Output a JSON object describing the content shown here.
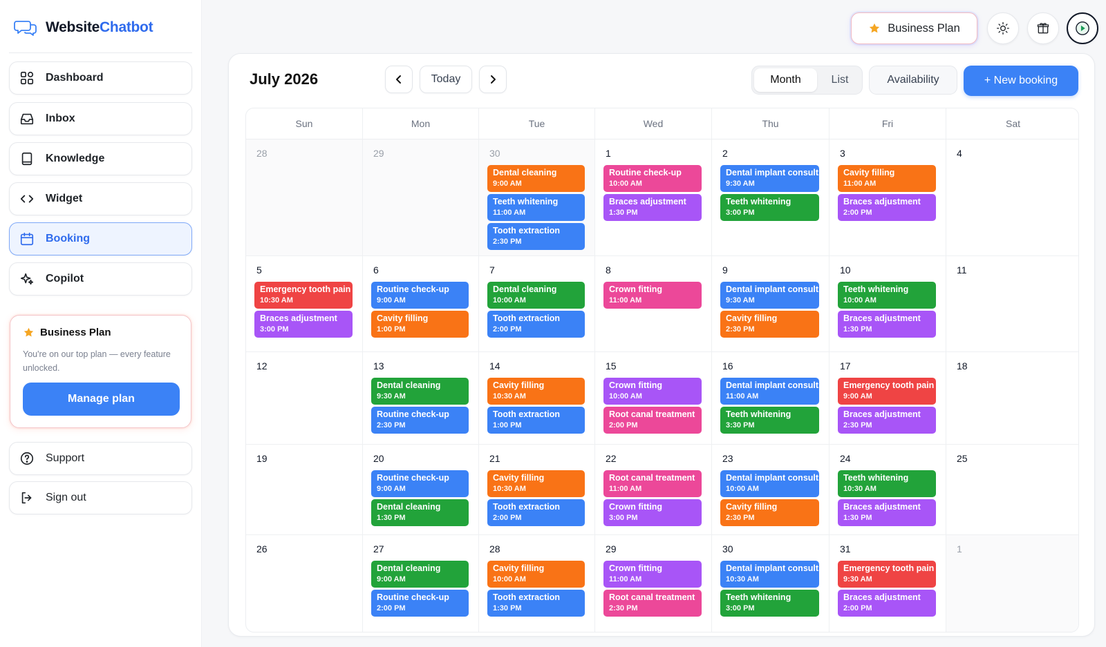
{
  "app": {
    "brand_main": "Website",
    "brand_accent": "Chatbot",
    "brand_icon": "chat-bubbles-icon"
  },
  "sidebar": {
    "items": [
      {
        "label": "Dashboard",
        "icon": "grid-icon",
        "active": false
      },
      {
        "label": "Inbox",
        "icon": "inbox-icon",
        "active": false
      },
      {
        "label": "Knowledge",
        "icon": "book-icon",
        "active": false
      },
      {
        "label": "Widget",
        "icon": "code-icon",
        "active": false
      },
      {
        "label": "Booking",
        "icon": "calendar-icon",
        "active": true
      },
      {
        "label": "Copilot",
        "icon": "sparkle-icon",
        "active": false
      }
    ],
    "plan_card": {
      "title": "Business Plan",
      "description": "You're on our top plan — every feature unlocked.",
      "button": "Manage plan"
    },
    "bottom_items": [
      {
        "label": "Support",
        "icon": "help-circle-icon"
      },
      {
        "label": "Sign out",
        "icon": "logout-icon"
      }
    ]
  },
  "topbar": {
    "plan_label": "Business Plan",
    "icons": [
      "sun-icon",
      "gift-icon",
      "play-avatar-icon"
    ]
  },
  "calendar": {
    "title": "July 2026",
    "today_label": "Today",
    "views": [
      "Month",
      "List"
    ],
    "active_view": "Month",
    "availability_label": "Availability",
    "new_booking_label": "+ New booking",
    "weekdays": [
      "Sun",
      "Mon",
      "Tue",
      "Wed",
      "Thu",
      "Fri",
      "Sat"
    ],
    "weeks": [
      [
        {
          "day": "28",
          "other": true,
          "events": []
        },
        {
          "day": "29",
          "other": true,
          "events": []
        },
        {
          "day": "30",
          "other": true,
          "events": [
            {
              "title": "Dental cleaning",
              "time": "9:00 AM",
              "color": "#f97316"
            },
            {
              "title": "Teeth whitening",
              "time": "11:00 AM",
              "color": "#3b82f6"
            },
            {
              "title": "Tooth extraction",
              "time": "2:30 PM",
              "color": "#3b82f6"
            }
          ]
        },
        {
          "day": "1",
          "other": false,
          "events": [
            {
              "title": "Routine check-up",
              "time": "10:00 AM",
              "color": "#ec4899"
            },
            {
              "title": "Braces adjustment",
              "time": "1:30 PM",
              "color": "#a855f7"
            }
          ]
        },
        {
          "day": "2",
          "other": false,
          "events": [
            {
              "title": "Dental implant consult.",
              "time": "9:30 AM",
              "color": "#3b82f6"
            },
            {
              "title": "Teeth whitening",
              "time": "3:00 PM",
              "color": "#22a33a"
            }
          ]
        },
        {
          "day": "3",
          "other": false,
          "events": [
            {
              "title": "Cavity filling",
              "time": "11:00 AM",
              "color": "#f97316"
            },
            {
              "title": "Braces adjustment",
              "time": "2:00 PM",
              "color": "#a855f7"
            }
          ]
        },
        {
          "day": "4",
          "other": false,
          "events": []
        }
      ],
      [
        {
          "day": "5",
          "other": false,
          "events": [
            {
              "title": "Emergency tooth pain",
              "time": "10:30 AM",
              "color": "#ef4444"
            },
            {
              "title": "Braces adjustment",
              "time": "3:00 PM",
              "color": "#a855f7"
            }
          ]
        },
        {
          "day": "6",
          "other": false,
          "events": [
            {
              "title": "Routine check-up",
              "time": "9:00 AM",
              "color": "#3b82f6"
            },
            {
              "title": "Cavity filling",
              "time": "1:00 PM",
              "color": "#f97316"
            }
          ]
        },
        {
          "day": "7",
          "other": false,
          "events": [
            {
              "title": "Dental cleaning",
              "time": "10:00 AM",
              "color": "#22a33a"
            },
            {
              "title": "Tooth extraction",
              "time": "2:00 PM",
              "color": "#3b82f6"
            }
          ]
        },
        {
          "day": "8",
          "other": false,
          "events": [
            {
              "title": "Crown fitting",
              "time": "11:00 AM",
              "color": "#ec4899"
            }
          ]
        },
        {
          "day": "9",
          "other": false,
          "events": [
            {
              "title": "Dental implant consult.",
              "time": "9:30 AM",
              "color": "#3b82f6"
            },
            {
              "title": "Cavity filling",
              "time": "2:30 PM",
              "color": "#f97316"
            }
          ]
        },
        {
          "day": "10",
          "other": false,
          "events": [
            {
              "title": "Teeth whitening",
              "time": "10:00 AM",
              "color": "#22a33a"
            },
            {
              "title": "Braces adjustment",
              "time": "1:30 PM",
              "color": "#a855f7"
            }
          ]
        },
        {
          "day": "11",
          "other": false,
          "events": []
        }
      ],
      [
        {
          "day": "12",
          "other": false,
          "events": []
        },
        {
          "day": "13",
          "other": false,
          "events": [
            {
              "title": "Dental cleaning",
              "time": "9:30 AM",
              "color": "#22a33a"
            },
            {
              "title": "Routine check-up",
              "time": "2:30 PM",
              "color": "#3b82f6"
            }
          ]
        },
        {
          "day": "14",
          "other": false,
          "events": [
            {
              "title": "Cavity filling",
              "time": "10:30 AM",
              "color": "#f97316"
            },
            {
              "title": "Tooth extraction",
              "time": "1:00 PM",
              "color": "#3b82f6"
            }
          ]
        },
        {
          "day": "15",
          "other": false,
          "events": [
            {
              "title": "Crown fitting",
              "time": "10:00 AM",
              "color": "#a855f7"
            },
            {
              "title": "Root canal treatment",
              "time": "2:00 PM",
              "color": "#ec4899"
            }
          ]
        },
        {
          "day": "16",
          "other": false,
          "events": [
            {
              "title": "Dental implant consult.",
              "time": "11:00 AM",
              "color": "#3b82f6"
            },
            {
              "title": "Teeth whitening",
              "time": "3:30 PM",
              "color": "#22a33a"
            }
          ]
        },
        {
          "day": "17",
          "other": false,
          "events": [
            {
              "title": "Emergency tooth pain",
              "time": "9:00 AM",
              "color": "#ef4444"
            },
            {
              "title": "Braces adjustment",
              "time": "2:30 PM",
              "color": "#a855f7"
            }
          ]
        },
        {
          "day": "18",
          "other": false,
          "events": []
        }
      ],
      [
        {
          "day": "19",
          "other": false,
          "events": []
        },
        {
          "day": "20",
          "other": false,
          "events": [
            {
              "title": "Routine check-up",
              "time": "9:00 AM",
              "color": "#3b82f6"
            },
            {
              "title": "Dental cleaning",
              "time": "1:30 PM",
              "color": "#22a33a"
            }
          ]
        },
        {
          "day": "21",
          "other": false,
          "events": [
            {
              "title": "Cavity filling",
              "time": "10:30 AM",
              "color": "#f97316"
            },
            {
              "title": "Tooth extraction",
              "time": "2:00 PM",
              "color": "#3b82f6"
            }
          ]
        },
        {
          "day": "22",
          "other": false,
          "events": [
            {
              "title": "Root canal treatment",
              "time": "11:00 AM",
              "color": "#ec4899"
            },
            {
              "title": "Crown fitting",
              "time": "3:00 PM",
              "color": "#a855f7"
            }
          ]
        },
        {
          "day": "23",
          "other": false,
          "events": [
            {
              "title": "Dental implant consult.",
              "time": "10:00 AM",
              "color": "#3b82f6"
            },
            {
              "title": "Cavity filling",
              "time": "2:30 PM",
              "color": "#f97316"
            }
          ]
        },
        {
          "day": "24",
          "other": false,
          "events": [
            {
              "title": "Teeth whitening",
              "time": "10:30 AM",
              "color": "#22a33a"
            },
            {
              "title": "Braces adjustment",
              "time": "1:30 PM",
              "color": "#a855f7"
            }
          ]
        },
        {
          "day": "25",
          "other": false,
          "events": []
        }
      ],
      [
        {
          "day": "26",
          "other": false,
          "events": []
        },
        {
          "day": "27",
          "other": false,
          "events": [
            {
              "title": "Dental cleaning",
              "time": "9:00 AM",
              "color": "#22a33a"
            },
            {
              "title": "Routine check-up",
              "time": "2:00 PM",
              "color": "#3b82f6"
            }
          ]
        },
        {
          "day": "28",
          "other": false,
          "events": [
            {
              "title": "Cavity filling",
              "time": "10:00 AM",
              "color": "#f97316"
            },
            {
              "title": "Tooth extraction",
              "time": "1:30 PM",
              "color": "#3b82f6"
            }
          ]
        },
        {
          "day": "29",
          "other": false,
          "events": [
            {
              "title": "Crown fitting",
              "time": "11:00 AM",
              "color": "#a855f7"
            },
            {
              "title": "Root canal treatment",
              "time": "2:30 PM",
              "color": "#ec4899"
            }
          ]
        },
        {
          "day": "30",
          "other": false,
          "events": [
            {
              "title": "Dental implant consult.",
              "time": "10:30 AM",
              "color": "#3b82f6"
            },
            {
              "title": "Teeth whitening",
              "time": "3:00 PM",
              "color": "#22a33a"
            }
          ]
        },
        {
          "day": "31",
          "other": false,
          "events": [
            {
              "title": "Emergency tooth pain",
              "time": "9:30 AM",
              "color": "#ef4444"
            },
            {
              "title": "Braces adjustment",
              "time": "2:00 PM",
              "color": "#a855f7"
            }
          ]
        },
        {
          "day": "1",
          "other": true,
          "events": []
        }
      ]
    ]
  }
}
